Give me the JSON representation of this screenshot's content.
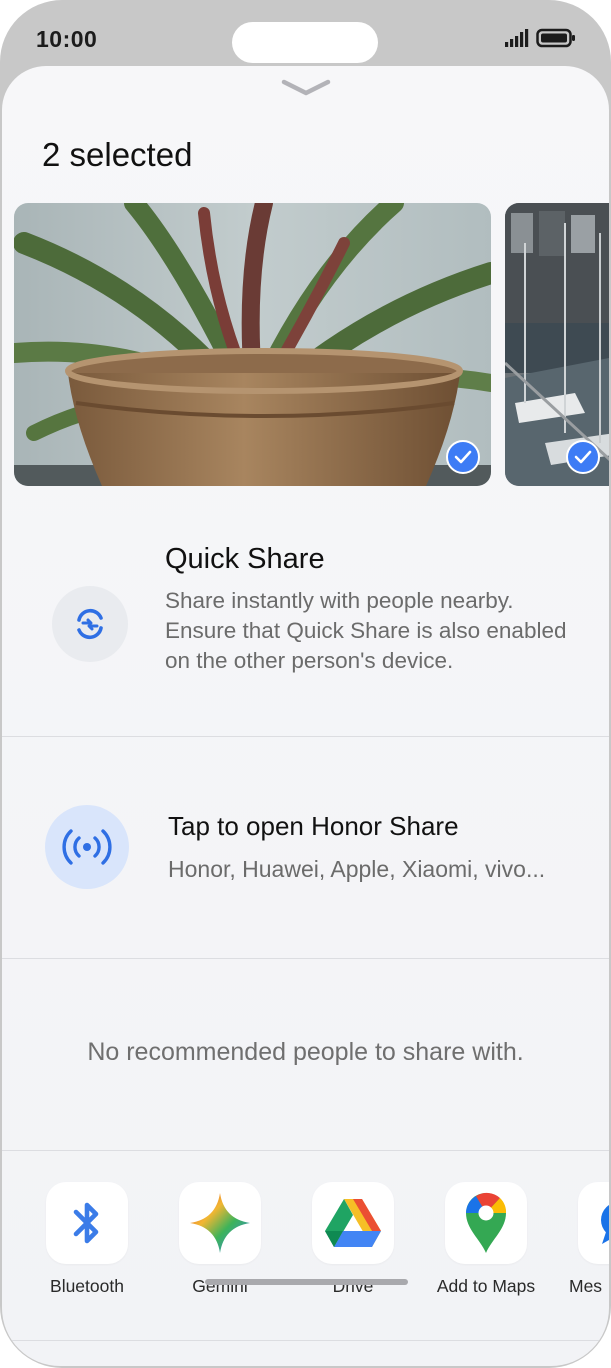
{
  "status_bar": {
    "time": "10:00",
    "signal_icon": "signal-bars-icon",
    "battery_icon": "battery-icon"
  },
  "sheet": {
    "handle_icon": "chevron-down-icon",
    "title": "2 selected"
  },
  "images": [
    {
      "subject": "potted-plant-photo",
      "selected": true
    },
    {
      "subject": "marina-boats-photo",
      "selected": true
    }
  ],
  "quick_share": {
    "title": "Quick Share",
    "description": "Share instantly with people nearby. Ensure that Quick Share is also enabled on the other person's device.",
    "icon": "quick-share-icon"
  },
  "honor_share": {
    "title": "Tap to open Honor Share",
    "subtitle": "Honor, Huawei, Apple, Xiaomi, vivo...",
    "icon": "broadcast-icon"
  },
  "recommendations": {
    "empty_text": "No recommended people to share with."
  },
  "apps": [
    {
      "label": "Bluetooth",
      "icon": "bluetooth-icon"
    },
    {
      "label": "Gemini",
      "icon": "gemini-icon"
    },
    {
      "label": "Drive",
      "icon": "drive-icon"
    },
    {
      "label": "Add to Maps",
      "icon": "maps-pin-icon"
    },
    {
      "label": "Mes",
      "icon": "messages-icon"
    }
  ],
  "colors": {
    "accent": "#3d7cf5",
    "sheet_bg": "#f5f6f8",
    "frame": "#c8c8c8"
  }
}
